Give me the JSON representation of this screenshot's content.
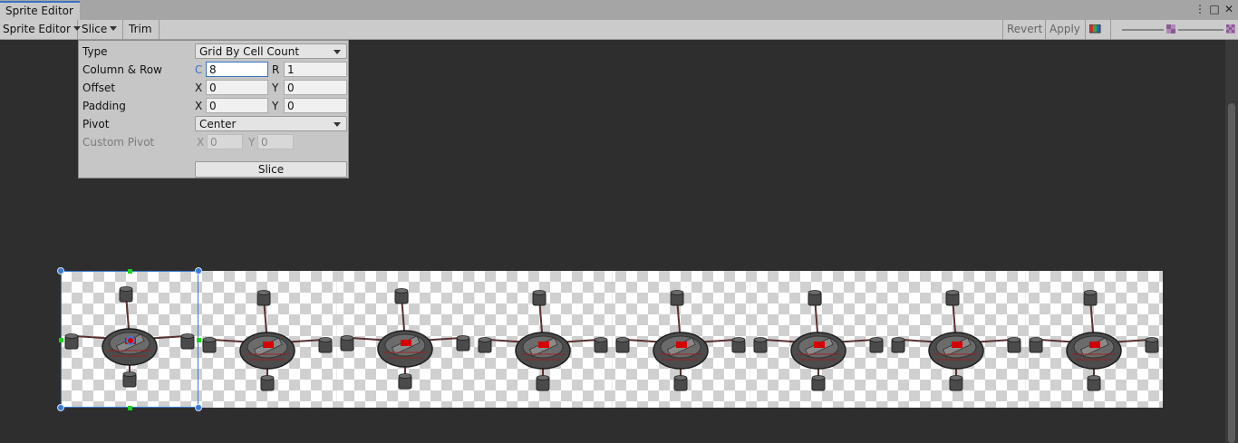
{
  "window": {
    "tab_title": "Sprite Editor"
  },
  "toolbar": {
    "sprite_editor_menu": "Sprite Editor",
    "slice_menu": "Slice",
    "trim_label": "Trim",
    "revert_label": "Revert",
    "apply_label": "Apply"
  },
  "slice_panel": {
    "type_label": "Type",
    "type_value": "Grid By Cell Count",
    "column_row_label": "Column & Row",
    "c_label": "C",
    "c_value": "8",
    "r_label": "R",
    "r_value": "1",
    "offset_label": "Offset",
    "offset_x_label": "X",
    "offset_x": "0",
    "offset_y_label": "Y",
    "offset_y": "0",
    "padding_label": "Padding",
    "padding_x_label": "X",
    "padding_x": "0",
    "padding_y_label": "Y",
    "padding_y": "0",
    "pivot_label": "Pivot",
    "pivot_value": "Center",
    "custom_pivot_label": "Custom Pivot",
    "custom_pivot_x_label": "X",
    "custom_pivot_x": "0",
    "custom_pivot_y_label": "Y",
    "custom_pivot_y": "0",
    "slice_button": "Slice"
  },
  "sprite_sheet": {
    "frame_count": 8,
    "selected_frame": 1
  },
  "colors": {
    "accent": "#3a72c4",
    "panel_bg": "#c6c6c6",
    "canvas_bg": "#2e2e2e",
    "drone_body": "#555555",
    "drone_accent": "#d40000"
  },
  "icons": [
    "chevron-down-icon",
    "kebab-menu-icon",
    "maximize-icon",
    "close-icon",
    "color-channel-icon",
    "zoom-slider",
    "mip-level-icon"
  ]
}
